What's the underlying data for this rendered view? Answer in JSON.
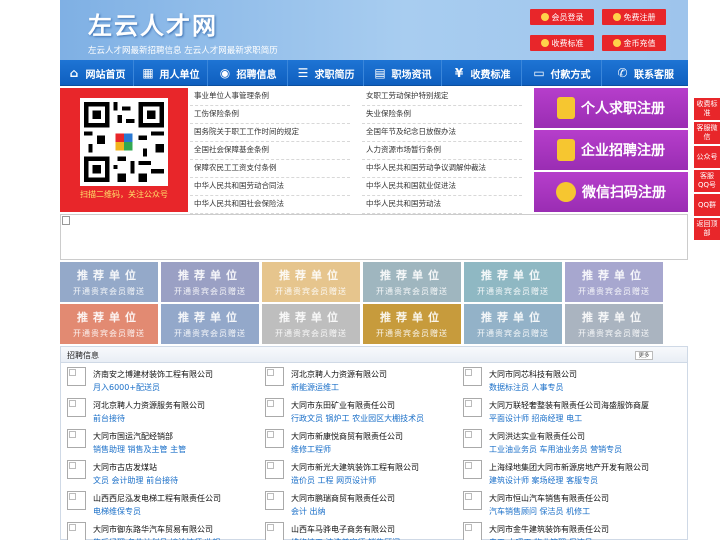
{
  "header": {
    "logo": "左云人才网",
    "slogan": "左云人才网最新招聘信息   左云人才网最新求职简历",
    "buttons": [
      "会员登录",
      "免费注册",
      "收费标准",
      "金币充值"
    ]
  },
  "nav": [
    {
      "label": "网站首页",
      "icon": "home-icon"
    },
    {
      "label": "用人单位",
      "icon": "building-icon"
    },
    {
      "label": "招聘信息",
      "icon": "megaphone-icon"
    },
    {
      "label": "求职简历",
      "icon": "resume-icon"
    },
    {
      "label": "职场资讯",
      "icon": "news-icon"
    },
    {
      "label": "收费标准",
      "icon": "coin-icon"
    },
    {
      "label": "付款方式",
      "icon": "card-icon"
    },
    {
      "label": "联系客服",
      "icon": "phone-icon"
    }
  ],
  "qr": {
    "caption": "扫描二维码，关注公众号"
  },
  "links": [
    [
      "事业单位人事管理条例",
      "女职工劳动保护特别规定"
    ],
    [
      "工伤保险条例",
      "失业保险条例"
    ],
    [
      "国务院关于职工工作时间的规定",
      "全国年节及纪念日放假办法"
    ],
    [
      "全国社会保障基金条例",
      "人力资源市场暂行条例"
    ],
    [
      "保障农民工工资支付条例",
      "中华人民共和国劳动争议调解仲裁法"
    ],
    [
      "中华人民共和国劳动合同法",
      "中华人民共和国就业促进法"
    ],
    [
      "中华人民共和国社会保险法",
      "中华人民共和国劳动法"
    ]
  ],
  "register": [
    {
      "label": "个人求职注册",
      "icon": "person-icon"
    },
    {
      "label": "企业招聘注册",
      "icon": "enterprise-icon"
    },
    {
      "label": "微信扫码注册",
      "icon": "wechat-icon"
    }
  ],
  "side": [
    "收费标准",
    "客服微信",
    "公众号",
    "客服QQ号",
    "QQ群",
    "返回顶部"
  ],
  "tiles": {
    "title": "推荐单位",
    "subtitle": "开通贵宾会员赠送",
    "colors": [
      "#94a9c9",
      "#9aa0c4",
      "#e6c58d",
      "#9fb6bf",
      "#8fb8c3",
      "#a7a7cf",
      "#e28a72",
      "#93a8ca",
      "#bebebe",
      "#c79b3c",
      "#93b2c8",
      "#aab4c0"
    ]
  },
  "jobs": {
    "title": "招聘信息",
    "more": "更多",
    "items": [
      [
        "济南安之博建材装饰工程有限公司",
        "月入6000+配送员"
      ],
      [
        "河北京聘人力资源有限公司",
        "新能源运维工"
      ],
      [
        "大同市同芯科技有限公司",
        "数据标注员 人事专员"
      ],
      [
        "河北京聘人力资源服务有限公司",
        "前台接待"
      ],
      [
        "大同市东田矿业有限责任公司",
        "行政文员 锅炉工 农业园区大棚技术员"
      ],
      [
        "大同万联轻奢整装有限责任公司海盛服饰商厦",
        "平面设计师 招商经理 电工"
      ],
      [
        "大同市国运汽配经销部",
        "销售助理 销售及主管 主管"
      ],
      [
        "大同市新康悦商贸有限责任公司",
        "维修工程师"
      ],
      [
        "大同洪达实业有限责任公司",
        "工业油业务员 车用油业务员 营销专员"
      ],
      [
        "大同市古店发煤站",
        "文员 会计助理 前台接待"
      ],
      [
        "大同市新光大建筑装饰工程有限公司",
        "造价员 工程 网页设计师"
      ],
      [
        "上海绿地集团大同市新源房地产开发有限公司",
        "建筑设计师 案场经理 客服专员"
      ],
      [
        "山西西尼泓发电梯工程有限责任公司",
        "电梯维保专员"
      ],
      [
        "大同市鹏瑞商贸有限责任公司",
        "会计 出纳"
      ],
      [
        "大同市恒山汽车销售有限责任公司",
        "汽车销售顾问 保洁员 机修工"
      ],
      [
        "大同市御东路华汽车贸易有限公司",
        "售后经理 备件计划员 接洽技师 收银"
      ],
      [
        "山西车马骅电子商务有限公司",
        "维修技工 清洗美容师 销售顾问"
      ],
      [
        "大同市金牛建筑装饰有限责任公司",
        "电工 水暖工 物业管理 保洁员"
      ]
    ]
  }
}
